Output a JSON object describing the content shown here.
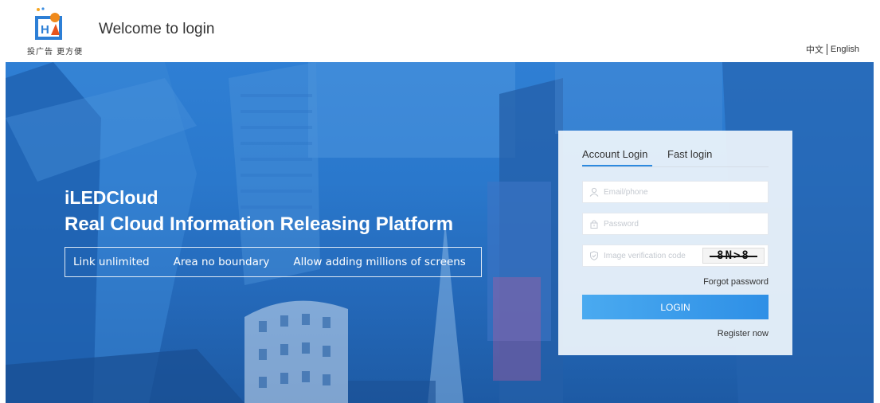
{
  "header": {
    "logo_slogan": "投广告 更方便",
    "welcome": "Welcome to login",
    "lang_zh": "中文",
    "lang_en": "English"
  },
  "hero": {
    "title": "iLEDCloud",
    "subtitle": "Real Cloud Information Releasing Platform",
    "features": [
      "Link unlimited",
      "Area no boundary",
      "Allow adding millions of screens"
    ]
  },
  "login": {
    "tab_account": "Account Login",
    "tab_fast": "Fast login",
    "email_placeholder": "Email/phone",
    "password_placeholder": "Password",
    "captcha_placeholder": "Image verification code",
    "captcha_text": "8N>8",
    "forgot": "Forgot password",
    "login_label": "LOGIN",
    "register": "Register now"
  },
  "colors": {
    "accent": "#2e8fe6",
    "hero_blue": "#2a78cc"
  }
}
